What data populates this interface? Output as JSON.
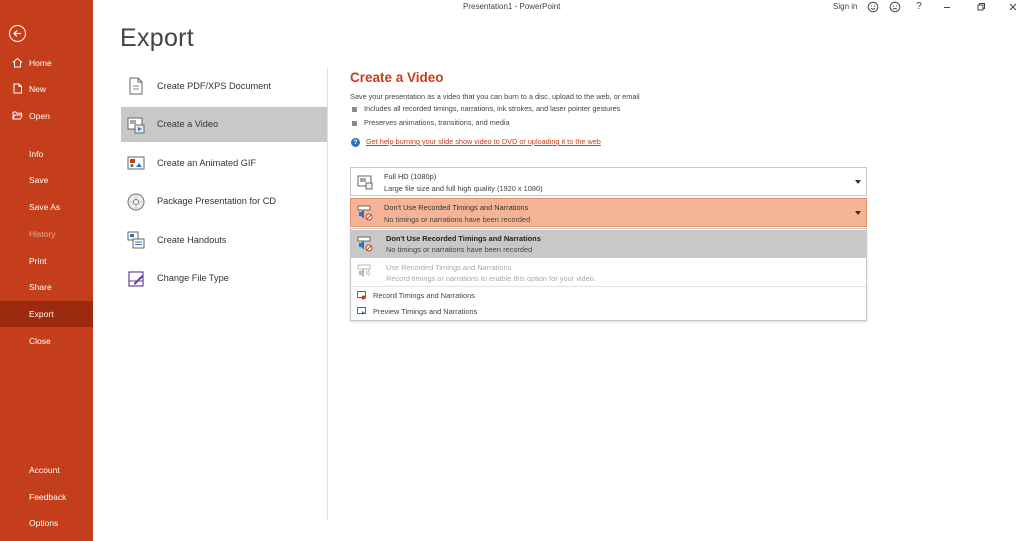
{
  "window": {
    "title": "Presentation1 - PowerPoint",
    "sign_in": "Sign in",
    "help": "?"
  },
  "nav": {
    "items": [
      {
        "label": "Home",
        "icon": "home-icon"
      },
      {
        "label": "New",
        "icon": "new-document-icon"
      },
      {
        "label": "Open",
        "icon": "folder-open-icon"
      },
      {
        "label": "Info"
      },
      {
        "label": "Save"
      },
      {
        "label": "Save As"
      },
      {
        "label": "History"
      },
      {
        "label": "Print"
      },
      {
        "label": "Share"
      },
      {
        "label": "Export"
      },
      {
        "label": "Close"
      },
      {
        "label": "Account"
      },
      {
        "label": "Feedback"
      },
      {
        "label": "Options"
      }
    ]
  },
  "page": {
    "title": "Export"
  },
  "export_options": [
    {
      "label": "Create PDF/XPS Document",
      "icon": "pdf-document-icon"
    },
    {
      "label": "Create a Video",
      "icon": "video-icon"
    },
    {
      "label": "Create an Animated GIF",
      "icon": "gif-icon"
    },
    {
      "label": "Package Presentation for CD",
      "icon": "cd-icon"
    },
    {
      "label": "Create Handouts",
      "icon": "handouts-icon"
    },
    {
      "label": "Change File Type",
      "icon": "change-file-type-icon"
    }
  ],
  "video": {
    "title": "Create a Video",
    "description": "Save your presentation as a video that you can burn to a disc, upload to the web, or email",
    "bullets": [
      "Includes all recorded timings, narrations, ink strokes, and laser pointer gestures",
      "Preserves animations, transitions, and media"
    ],
    "help_link": "Get help burning your slide show video to DVD or uploading it to the web",
    "quality": {
      "title": "Full HD (1080p)",
      "subtitle": "Large file size and full high quality (1920 x 1080)"
    },
    "timings": {
      "title": "Don't Use Recorded Timings and Narrations",
      "subtitle": "No timings or narrations have been recorded"
    },
    "menu": {
      "options": [
        {
          "title": "Don't Use Recorded Timings and Narrations",
          "subtitle": "No timings or narrations have been recorded"
        },
        {
          "title": "Use Recorded Timings and Narrations",
          "subtitle": "Record timings or narrations to enable this option for your video."
        }
      ],
      "actions": [
        {
          "label": "Record Timings and Narrations",
          "icon": "record-icon"
        },
        {
          "label": "Preview Timings and Narrations",
          "icon": "preview-icon"
        }
      ]
    }
  },
  "colors": {
    "accent": "#c43e1c",
    "nav_active": "#9c2a0f",
    "dropdown_open": "#f4b495",
    "selected": "#c8c8c8",
    "link_icon": "#2b73c7"
  }
}
